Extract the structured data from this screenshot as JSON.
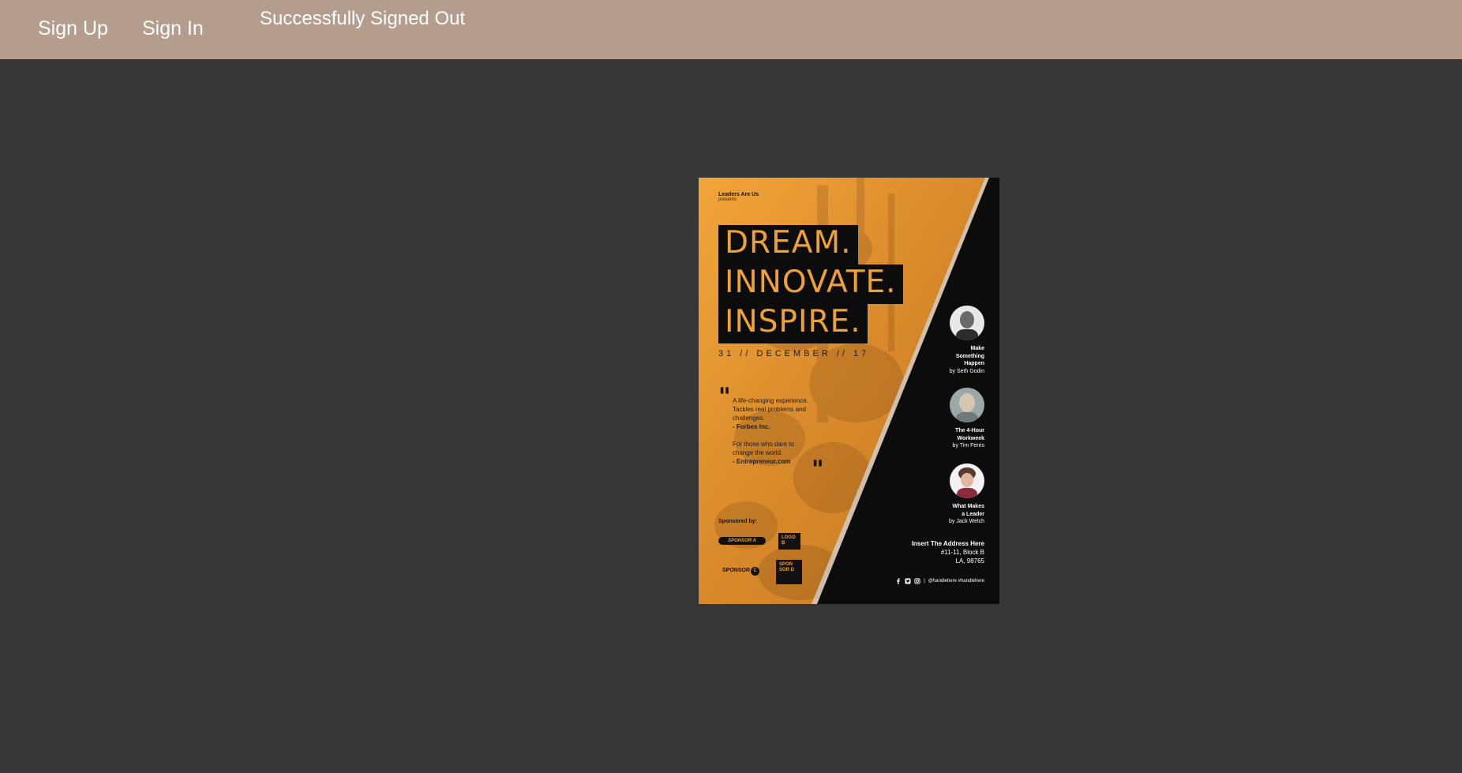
{
  "nav": {
    "signup_label": "Sign Up",
    "signin_label": "Sign In",
    "status_message": "Successfully Signed Out"
  },
  "poster": {
    "presenter": "Leaders Are Us",
    "presents": "presents",
    "headline": [
      "DREAM.",
      "INNOVATE.",
      "INSPIRE."
    ],
    "date": "31 // DECEMBER // 17",
    "quotes": [
      {
        "text_lines": [
          "A life-changing experience.",
          "Tackles real problems and",
          "challenges."
        ],
        "source": "- Forbes Inc."
      },
      {
        "text_lines": [
          "For those who dare to",
          "change the world."
        ],
        "source": "- Entrepreneur.com"
      }
    ],
    "sponsored_by": "Sponsored by:",
    "sponsor_a": "SPONSOR A",
    "logo_b": "LOGO B",
    "sponsor_c": "SPONSOR",
    "sponsor_c_letter": "C",
    "sponsor_d": "SPON SOR D",
    "books": [
      {
        "title_lines": [
          "Make",
          "Something",
          "Happen"
        ],
        "author": "by Seth Godin"
      },
      {
        "title_lines": [
          "The 4-Hour",
          "Workweek"
        ],
        "author": "by Tim Ferris"
      },
      {
        "title_lines": [
          "What Makes",
          "a Leader"
        ],
        "author": "by Jack Welch"
      }
    ],
    "address": {
      "heading": "Insert The Address Here",
      "line1": "#11-11, Block B",
      "line2": "LA, 98765"
    },
    "social": {
      "separator": "|",
      "handles": "@handlehere #handlehere",
      "icons": [
        "facebook-icon",
        "twitter-icon",
        "instagram-icon"
      ]
    },
    "colors": {
      "orange": "#e89a2e",
      "black": "#0c0c0c"
    }
  }
}
